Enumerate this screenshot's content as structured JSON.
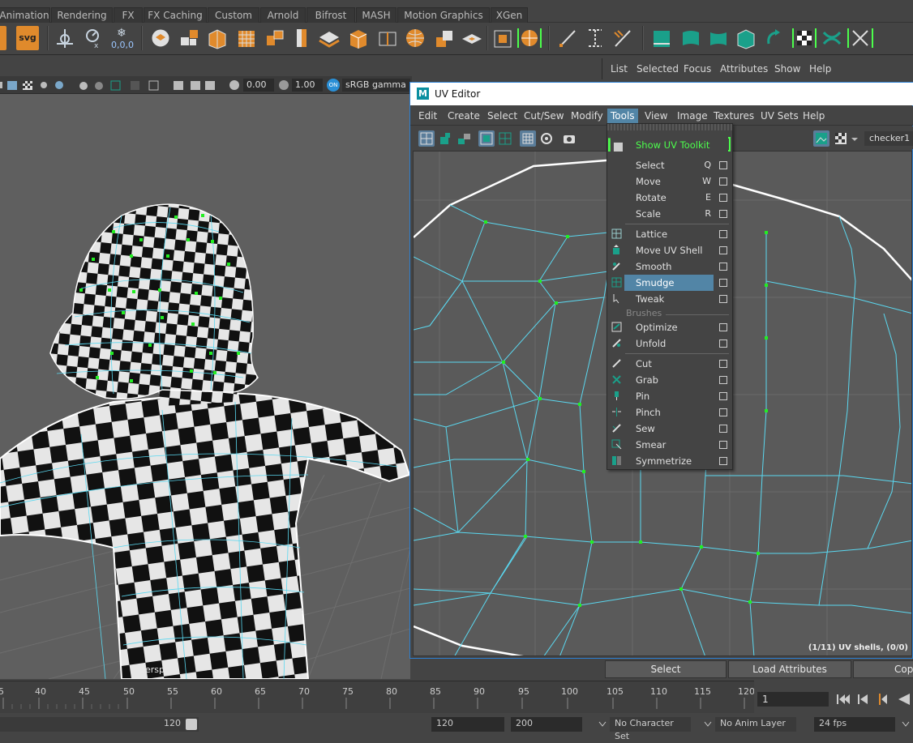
{
  "shelf_tabs": [
    "Animation",
    "Rendering",
    "FX",
    "FX Caching",
    "Custom",
    "Arnold",
    "Bifrost",
    "MASH",
    "Motion Graphics",
    "XGen"
  ],
  "shelf": {
    "svg_label": "svg",
    "coords_label": "0,0,0"
  },
  "channel_box_menu": [
    "List",
    "Selected",
    "Focus",
    "Attributes",
    "Show",
    "Help"
  ],
  "viewport_toolbar": {
    "exposure": "0.00",
    "gamma": "1.00",
    "color_space": "sRGB gamma",
    "on_badge": "ON"
  },
  "viewport": {
    "camera_label": "persp"
  },
  "uv_editor": {
    "logo": "M",
    "title": "UV Editor",
    "menus": [
      "Edit",
      "Create",
      "Select",
      "Cut/Sew",
      "Modify",
      "Tools",
      "View",
      "Image",
      "Textures",
      "UV Sets",
      "Help"
    ],
    "active_menu": "Tools",
    "texture_name": "checker1",
    "status": "(1/11) UV shells, (0/0)"
  },
  "tools_menu": {
    "toolkit_label": "Show UV Toolkit",
    "items_a": [
      {
        "label": "Select",
        "key": "Q"
      },
      {
        "label": "Move",
        "key": "W"
      },
      {
        "label": "Rotate",
        "key": "E"
      },
      {
        "label": "Scale",
        "key": "R"
      }
    ],
    "items_b": [
      {
        "label": "Lattice"
      },
      {
        "label": "Move UV Shell"
      },
      {
        "label": "Smooth"
      },
      {
        "label": "Smudge"
      },
      {
        "label": "Tweak"
      }
    ],
    "highlighted": "Smudge",
    "section_brushes": "Brushes",
    "items_c": [
      {
        "label": "Optimize"
      },
      {
        "label": "Unfold"
      }
    ],
    "items_d": [
      {
        "label": "Cut"
      },
      {
        "label": "Grab"
      },
      {
        "label": "Pin"
      },
      {
        "label": "Pinch"
      },
      {
        "label": "Sew"
      },
      {
        "label": "Smear"
      },
      {
        "label": "Symmetrize"
      }
    ]
  },
  "attribute_buttons": [
    "Select",
    "Load Attributes",
    "Copy"
  ],
  "timeline": {
    "ticks": [
      "5",
      "40",
      "45",
      "50",
      "55",
      "60",
      "65",
      "70",
      "75",
      "80",
      "85",
      "90",
      "95",
      "100",
      "105",
      "110",
      "115",
      "120"
    ],
    "current_frame": "1"
  },
  "range_bar": {
    "range_end": "120",
    "start": "120",
    "end": "200",
    "character_set": "No Character Set",
    "anim_layer": "No Anim Layer",
    "fps": "24 fps"
  },
  "colors": {
    "accent": "#5285a6",
    "uv_wire": "#5ad8f0",
    "vertex": "#22ee22",
    "toolkit_green": "#4cff4c"
  }
}
